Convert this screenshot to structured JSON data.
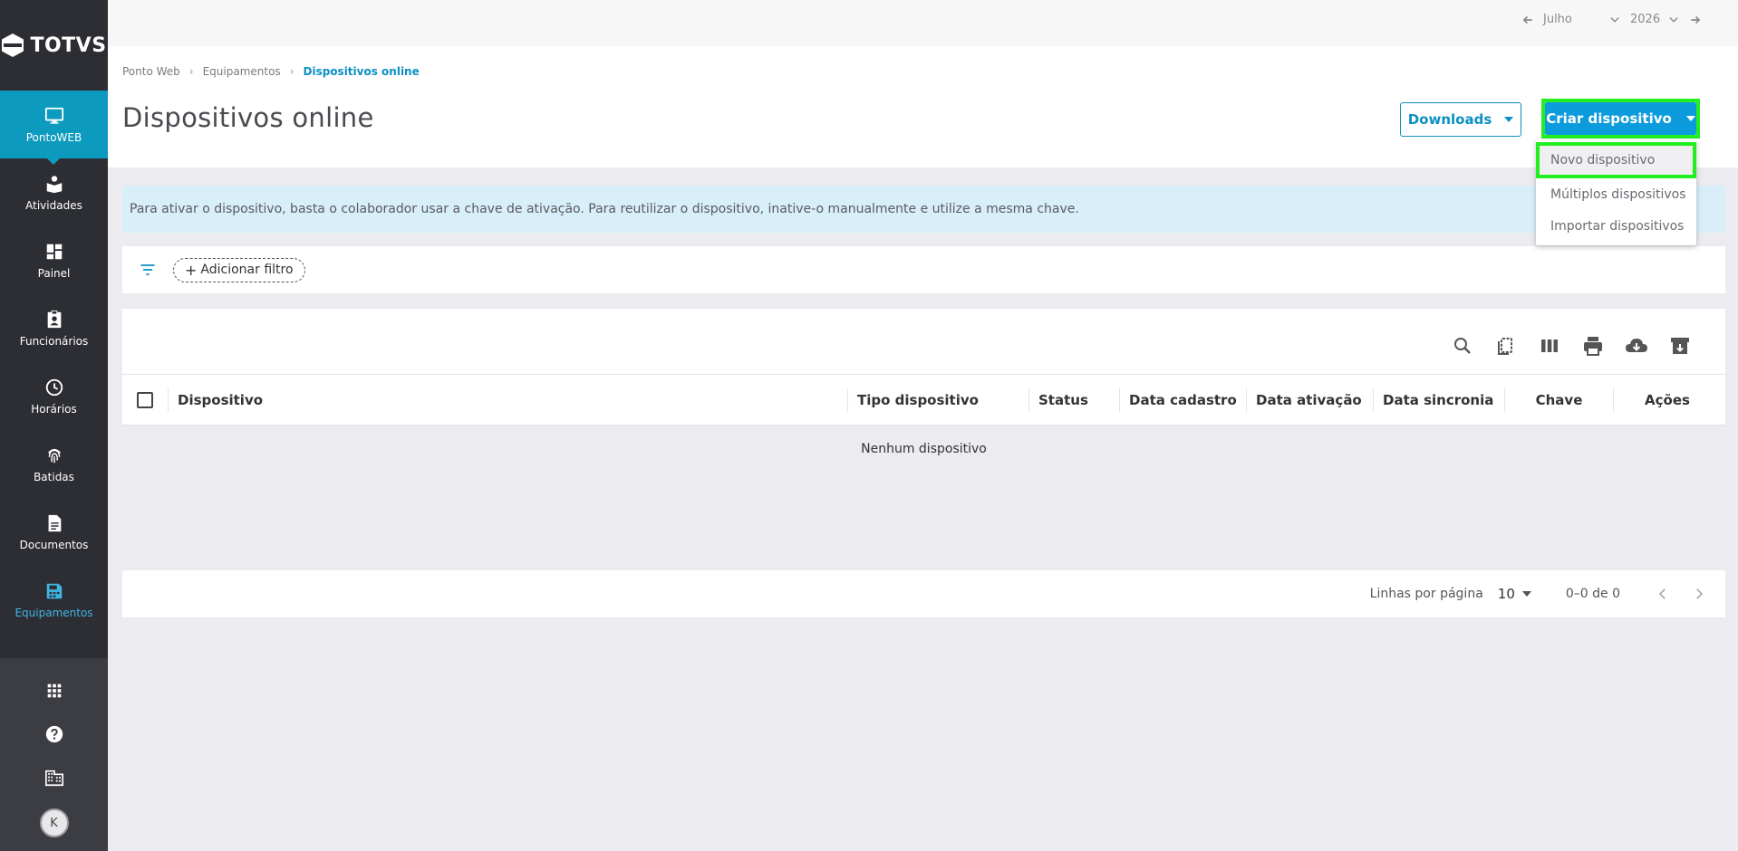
{
  "brand": {
    "name": "TOTVS"
  },
  "sidebar": {
    "items": [
      {
        "label": "PontoWEB",
        "icon": "monitor-icon"
      },
      {
        "label": "Atividades",
        "icon": "book-icon"
      },
      {
        "label": "Painel",
        "icon": "dashboard-icon"
      },
      {
        "label": "Funcionários",
        "icon": "badge-icon"
      },
      {
        "label": "Horários",
        "icon": "clock-icon"
      },
      {
        "label": "Batidas",
        "icon": "fingerprint-icon"
      },
      {
        "label": "Documentos",
        "icon": "document-icon"
      },
      {
        "label": "Equipamentos",
        "icon": "device-icon"
      }
    ],
    "avatar_initial": "K"
  },
  "topbar": {
    "month": "Julho",
    "year": "2026"
  },
  "breadcrumb": {
    "root": "Ponto Web",
    "parent": "Equipamentos",
    "current": "Dispositivos online"
  },
  "page": {
    "title": "Dispositivos online"
  },
  "actions": {
    "downloads_label": "Downloads",
    "criar_label": "Criar dispositivo",
    "menu": [
      "Novo dispositivo",
      "Múltiplos dispositivos",
      "Importar dispositivos"
    ]
  },
  "info_text": "Para ativar o dispositivo, basta o colaborador usar a chave de ativação. Para reutilizar o dispositivo, inative-o manualmente e utilize a mesma chave.",
  "filter": {
    "add_label": "Adicionar filtro"
  },
  "table": {
    "columns": [
      "Dispositivo",
      "Tipo dispositivo",
      "Status",
      "Data cadastro",
      "Data ativação",
      "Data sincronia",
      "Chave",
      "Ações"
    ],
    "empty_text": "Nenhum dispositivo",
    "rows_per_page_label": "Linhas por página",
    "rows_per_page": "10",
    "range_text": "0–0 de 0"
  },
  "colors": {
    "accent": "#0c9bdc",
    "highlight": "#22ee22",
    "sidebar": "#2d2e33"
  }
}
